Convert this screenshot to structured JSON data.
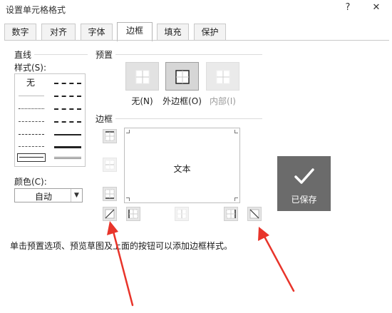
{
  "dialog": {
    "title": "设置单元格格式",
    "help_glyph": "?",
    "close_glyph": "✕"
  },
  "tabs": [
    {
      "label": "数字",
      "active": false
    },
    {
      "label": "对齐",
      "active": false
    },
    {
      "label": "字体",
      "active": false
    },
    {
      "label": "边框",
      "active": true
    },
    {
      "label": "填充",
      "active": false
    },
    {
      "label": "保护",
      "active": false
    }
  ],
  "line": {
    "group_label": "直线",
    "style_label": "样式(S):",
    "none_label": "无",
    "color_label": "颜色(C):",
    "color_value": "自动"
  },
  "presets": {
    "group_label": "预置",
    "items": [
      {
        "label": "无(N)",
        "icon": "preset-none-icon",
        "enabled": true
      },
      {
        "label": "外边框(O)",
        "icon": "preset-outline-icon",
        "enabled": true
      },
      {
        "label": "内部(I)",
        "icon": "preset-inside-icon",
        "enabled": false
      }
    ]
  },
  "border": {
    "group_label": "边框",
    "preview_text": "文本",
    "buttons": [
      {
        "icon": "border-top-icon",
        "enabled": true
      },
      {
        "icon": "border-inside-horizontal-icon",
        "enabled": false
      },
      {
        "icon": "border-bottom-icon",
        "enabled": true
      },
      {
        "icon": "border-diagonal-up-icon",
        "enabled": true
      },
      {
        "icon": "border-left-icon",
        "enabled": true
      },
      {
        "icon": "border-inside-vertical-icon",
        "enabled": false
      },
      {
        "icon": "border-right-icon",
        "enabled": true
      },
      {
        "icon": "border-diagonal-down-icon",
        "enabled": true
      }
    ]
  },
  "overlay": {
    "saved_text": "已保存",
    "badge_color": "#6b6b6b",
    "arrow_color": "#e8342a"
  },
  "hint": "单击预置选项、预览草图及上面的按钮可以添加边框样式。"
}
